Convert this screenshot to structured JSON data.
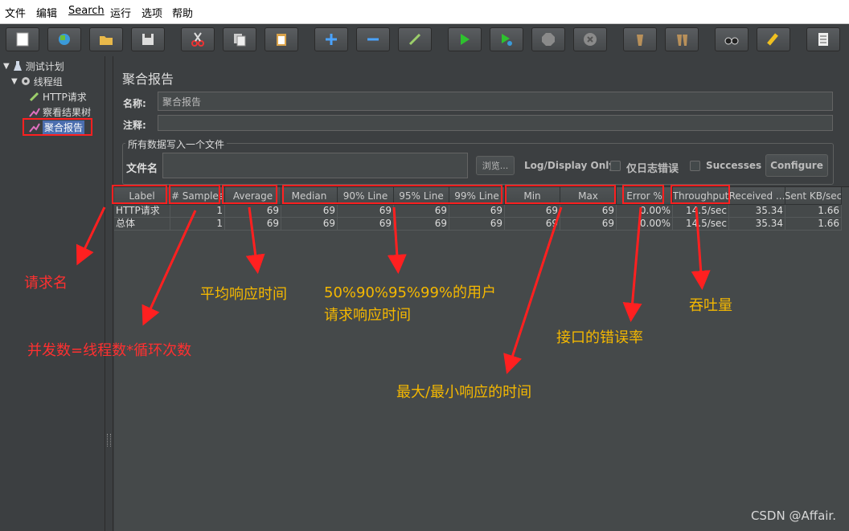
{
  "menu": [
    "文件",
    "编辑",
    "Search",
    "运行",
    "选项",
    "帮助"
  ],
  "toolbar": [
    "new-icon",
    "templates-icon",
    "open-icon",
    "save-icon",
    "cut-icon",
    "copy-icon",
    "paste-icon",
    "expand-icon",
    "collapse-icon",
    "toggle-icon",
    "start-icon",
    "start-no-pause-icon",
    "stop-icon",
    "shutdown-icon",
    "clear-icon",
    "clear-all-icon",
    "search-icon",
    "reset-search-icon",
    "function-helper-icon"
  ],
  "tree": {
    "test_plan": "测试计划",
    "thread_group": "线程组",
    "http_request": "HTTP请求",
    "view_results_tree": "察看结果树",
    "aggregate_report": "聚合报告"
  },
  "panel": {
    "title": "聚合报告",
    "name_label": "名称:",
    "name_value": "聚合报告",
    "comment_label": "注释:",
    "file_group_title": "所有数据写入一个文件",
    "filename_label": "文件名",
    "browse_button": "浏览...",
    "log_display_label": "Log/Display Only:",
    "errors_checkbox": "仅日志错误",
    "successes_checkbox": "Successes",
    "configure_button": "Configure"
  },
  "table": {
    "headers": [
      "Label",
      "# Samples",
      "Average",
      "Median",
      "90% Line",
      "95% Line",
      "99% Line",
      "Min",
      "Max",
      "Error %",
      "Throughput",
      "Received ...",
      "Sent KB/sec"
    ],
    "rows": [
      [
        "HTTP请求",
        "1",
        "69",
        "69",
        "69",
        "69",
        "69",
        "69",
        "69",
        "0.00%",
        "14.5/sec",
        "35.34",
        "1.66"
      ],
      [
        "总体",
        "1",
        "69",
        "69",
        "69",
        "69",
        "69",
        "69",
        "69",
        "0.00%",
        "14.5/sec",
        "35.34",
        "1.66"
      ]
    ]
  },
  "annotations": {
    "request_name": "请求名",
    "concurrency": "并发数=线程数*循环次数",
    "average": "平均响应时间",
    "percentiles_line1": "50%90%95%99%的用户",
    "percentiles_line2": "请求响应时间",
    "min_max": "最大/最小响应的时间",
    "error_rate": "接口的错误率",
    "throughput": "吞吐量"
  },
  "watermark": "CSDN @Affair.",
  "colors": {
    "annotation_red": "#ff3030",
    "annotation_yellow": "#f5b800",
    "selection": "#4b6eaf"
  }
}
